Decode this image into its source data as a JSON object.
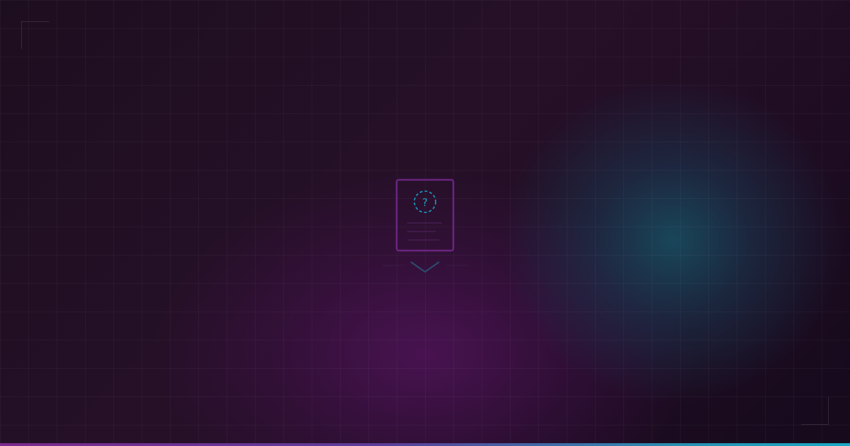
{
  "background": {
    "base_color": "#1c0f1f",
    "glow_teal": "#1a5064",
    "glow_purple": "#551460",
    "grid": true
  },
  "emblem": {
    "icon": "unknown-document-icon",
    "glyph": "?",
    "frame_color": "#6a2580",
    "accent_color": "#1e9bbd",
    "chevron_icon": "chevron-down-icon"
  },
  "bottom_bar": {
    "colors": [
      "#7a2a8c",
      "#5b3d99",
      "#2a8fb0",
      "#19a9c4"
    ]
  }
}
